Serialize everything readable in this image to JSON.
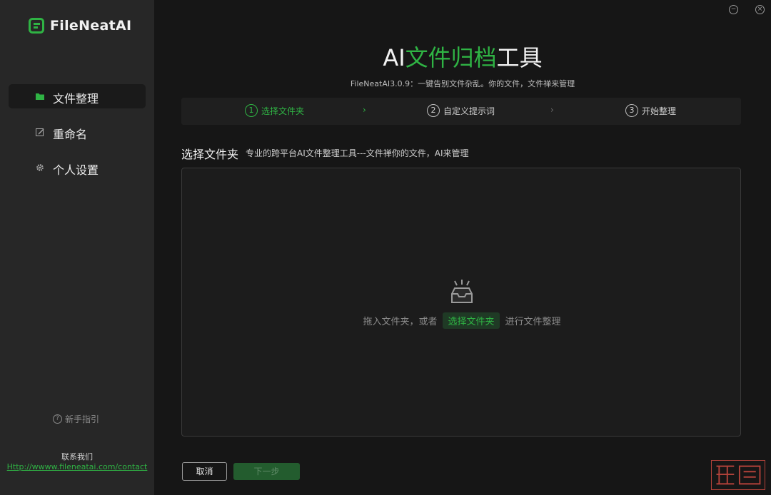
{
  "app": {
    "brand": "FileNeatAI",
    "accent_color": "#2fb344"
  },
  "sidebar": {
    "items": [
      {
        "label": "文件整理",
        "icon": "folder-icon",
        "active": true
      },
      {
        "label": "重命名",
        "icon": "edit-icon",
        "active": false
      },
      {
        "label": "个人设置",
        "icon": "gear-icon",
        "active": false
      }
    ],
    "guide_label": "新手指引",
    "guide_icon": "question-circle-icon",
    "contact_title": "联系我们",
    "contact_link": "Http://wwww.fileneatai.com/contact"
  },
  "window": {
    "minimize_icon": "minimize-circle-icon",
    "close_icon": "close-circle-icon"
  },
  "header": {
    "title_prefix": "AI",
    "title_accent": "文件归档",
    "title_suffix": "工具",
    "subtitle": "FileNeatAI3.0.9：一键告别文件杂乱。你的文件，文件禅来管理"
  },
  "steps": [
    {
      "num": "1",
      "label": "选择文件夹",
      "active": true
    },
    {
      "num": "2",
      "label": "自定义提示词",
      "active": false
    },
    {
      "num": "3",
      "label": "开始整理",
      "active": false
    }
  ],
  "section": {
    "title": "选择文件夹",
    "description": "专业的跨平台AI文件整理工具---文件禅你的文件，AI来管理"
  },
  "dropzone": {
    "icon": "inbox-icon",
    "text_before": "拖入文件夹，或者",
    "pill_label": "选择文件夹",
    "text_after": "进行文件整理"
  },
  "footer": {
    "cancel_label": "取消",
    "next_label": "下一步"
  }
}
